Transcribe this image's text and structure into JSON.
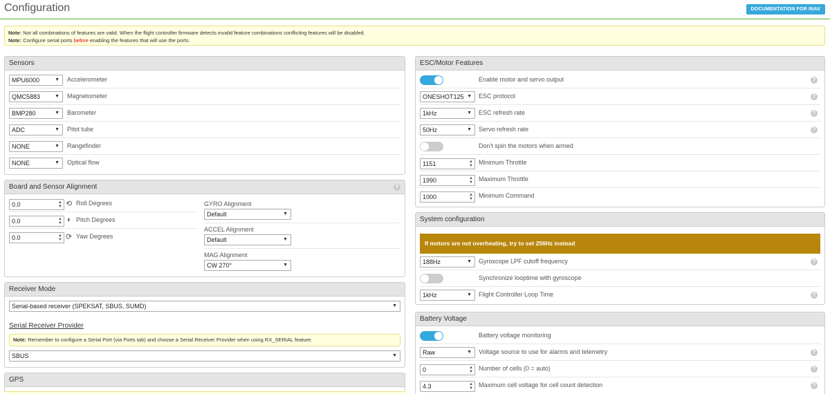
{
  "header": {
    "title": "Configuration",
    "doc_button": "DOCUMENTATION FOR INAV"
  },
  "note": {
    "line1_prefix": "Note:",
    "line1_text": " Not all combinations of features are valid. When the flight controller firmware detects invalid feature combinations conflicting features will be disabled.",
    "line2_prefix": "Note:",
    "line2_a": " Configure serial ports ",
    "line2_red": "before",
    "line2_b": " enabling the features that will use the ports."
  },
  "sensors": {
    "title": "Sensors",
    "rows": [
      {
        "value": "MPU6000",
        "label": "Accelerometer"
      },
      {
        "value": "QMC5883",
        "label": "Magnetometer"
      },
      {
        "value": "BMP280",
        "label": "Barometer"
      },
      {
        "value": "ADC",
        "label": "Pitot tube"
      },
      {
        "value": "NONE",
        "label": "Rangefinder"
      },
      {
        "value": "NONE",
        "label": "Optical flow"
      }
    ]
  },
  "alignment": {
    "title": "Board and Sensor Alignment",
    "rows": [
      {
        "value": "0.0",
        "label": "Roll Degrees"
      },
      {
        "value": "0.0",
        "label": "Pitch Degrees"
      },
      {
        "value": "0.0",
        "label": "Yaw Degrees"
      }
    ],
    "gyro": {
      "label": "GYRO Alignment",
      "value": "Default"
    },
    "accel": {
      "label": "ACCEL Alignment",
      "value": "Default"
    },
    "mag": {
      "label": "MAG Alignment",
      "value": "CW 270°"
    }
  },
  "receiver": {
    "title": "Receiver Mode",
    "mode": "Serial-based receiver (SPEKSAT, SBUS, SUMD)",
    "provider_label": "Serial Receiver Provider",
    "note_prefix": "Note:",
    "note_text": " Remember to configure a Serial Port (via Ports tab) and choose a Serial Receiver Provider when using RX_SERIAL feature.",
    "provider": "SBUS"
  },
  "gps": {
    "title": "GPS"
  },
  "esc": {
    "title": "ESC/Motor Features",
    "motor_output": "Enable motor and servo output",
    "protocol": {
      "value": "ONESHOT125",
      "label": "ESC protocol"
    },
    "refresh": {
      "value": "1kHz",
      "label": "ESC refresh rate"
    },
    "servo": {
      "value": "50Hz",
      "label": "Servo refresh rate"
    },
    "no_spin": "Don't spin the motors when armed",
    "min_throttle": {
      "value": "1151",
      "label": "Minimum Throttle"
    },
    "max_throttle": {
      "value": "1990",
      "label": "Maximum Throttle"
    },
    "min_command": {
      "value": "1000",
      "label": "Minimum Command"
    }
  },
  "system": {
    "title": "System configuration",
    "warning": "If motors are not overheating, try to set 256Hz instead",
    "lpf": {
      "value": "188Hz",
      "label": "Gyroscope LPF cutoff frequency"
    },
    "sync": "Synchronize looptime with gyroscope",
    "loop": {
      "value": "1kHz",
      "label": "Flight Controller Loop Time"
    }
  },
  "battery": {
    "title": "Battery Voltage",
    "monitoring": "Battery voltage monitoring",
    "source": {
      "value": "Raw",
      "label": "Voltage source to use for alarms and telemetry"
    },
    "cells": {
      "value": "0",
      "label": "Number of cells (0 = auto)"
    },
    "max_cell": {
      "value": "4.3",
      "label": "Maximum cell voltage for cell count detection"
    }
  },
  "icons": {
    "help": "?",
    "dropdown": "▼",
    "spinner": "▲▼"
  }
}
